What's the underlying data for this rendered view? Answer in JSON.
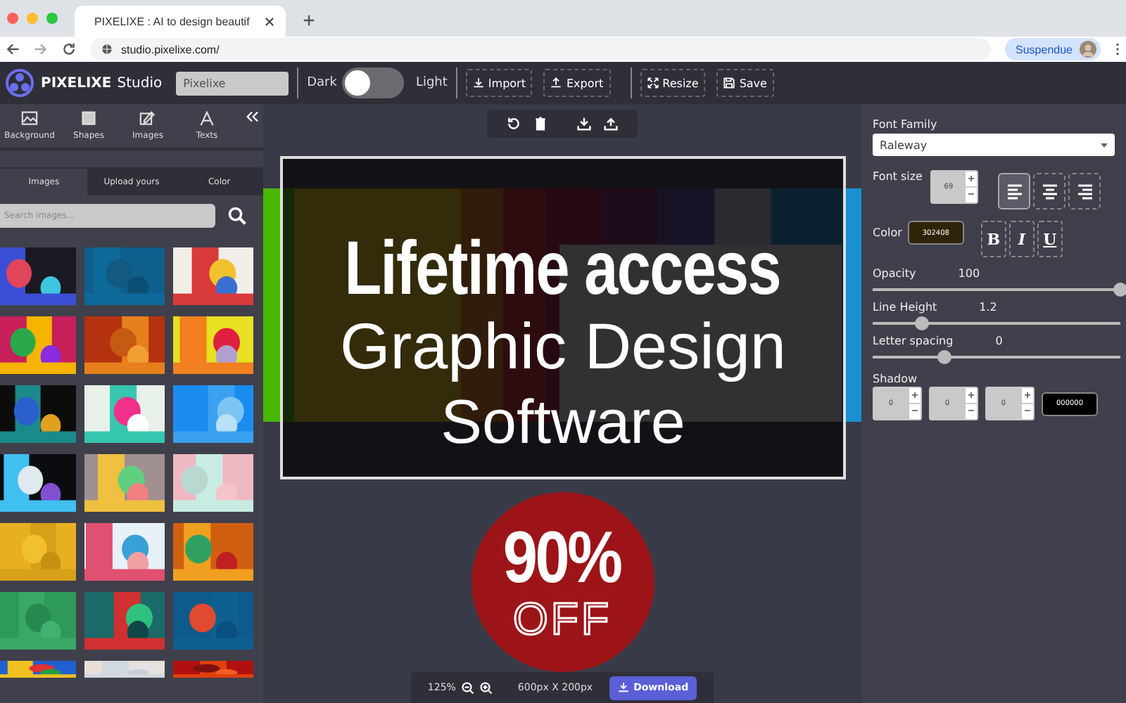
{
  "browser": {
    "tab_title": "PIXELIXE : AI to design beautif",
    "url": "studio.pixelixe.com/",
    "profile": "Suspendue"
  },
  "toolbar": {
    "brand": "PIXELIXE",
    "product": "Studio",
    "project_name": "Pixelixe",
    "dark_label": "Dark",
    "light_label": "Light",
    "light_mode": false,
    "buttons": [
      {
        "label": "Import",
        "kind": "import"
      },
      {
        "label": "Export",
        "kind": "export"
      },
      {
        "label": "Resize",
        "kind": "resize"
      },
      {
        "label": "Save",
        "kind": "save"
      }
    ]
  },
  "sidebar": {
    "tools": [
      {
        "label": "Background",
        "kind": "background"
      },
      {
        "label": "Shapes",
        "kind": "shapes"
      },
      {
        "label": "Images",
        "kind": "images"
      },
      {
        "label": "Texts",
        "kind": "texts"
      }
    ],
    "tabs": [
      {
        "label": "Images",
        "selected": true
      },
      {
        "label": "Upload yours",
        "selected": false
      },
      {
        "label": "Color",
        "selected": false
      }
    ],
    "search": {
      "placeholder": "Search images..."
    }
  },
  "canvas": {
    "promo": {
      "headline": "Lifetime access",
      "line_2": "Graphic Design",
      "line_3": "Software"
    },
    "badge": {
      "amount": "90%",
      "text": "OFF"
    },
    "zoom": "125%",
    "size": "600px X 200px",
    "download": "Download"
  },
  "properties": {
    "font_family": {
      "label": "Font Family",
      "value": "Raleway"
    },
    "font_size": {
      "label": "Font size",
      "value": "69"
    },
    "align": [
      {
        "kind": "left",
        "selected": true
      },
      {
        "kind": "center",
        "selected": false
      },
      {
        "kind": "right",
        "selected": false
      }
    ],
    "color": {
      "label": "Color",
      "value": "302408"
    },
    "styles": [
      {
        "label": "B",
        "kind": "bold",
        "on": false
      },
      {
        "label": "I",
        "kind": "italic",
        "on": false
      },
      {
        "label": "U",
        "kind": "underline",
        "on": false
      }
    ],
    "sliders": [
      {
        "label": "Opacity",
        "reading": "100",
        "level": 1
      },
      {
        "label": "Line Height",
        "reading": "1.2",
        "level": 0.2
      },
      {
        "label": "Letter spacing",
        "reading": "0",
        "level": 0.29
      }
    ],
    "shadow": {
      "label": "Shadow",
      "values": [
        "0",
        "0",
        "0"
      ],
      "hex": "000000"
    }
  }
}
